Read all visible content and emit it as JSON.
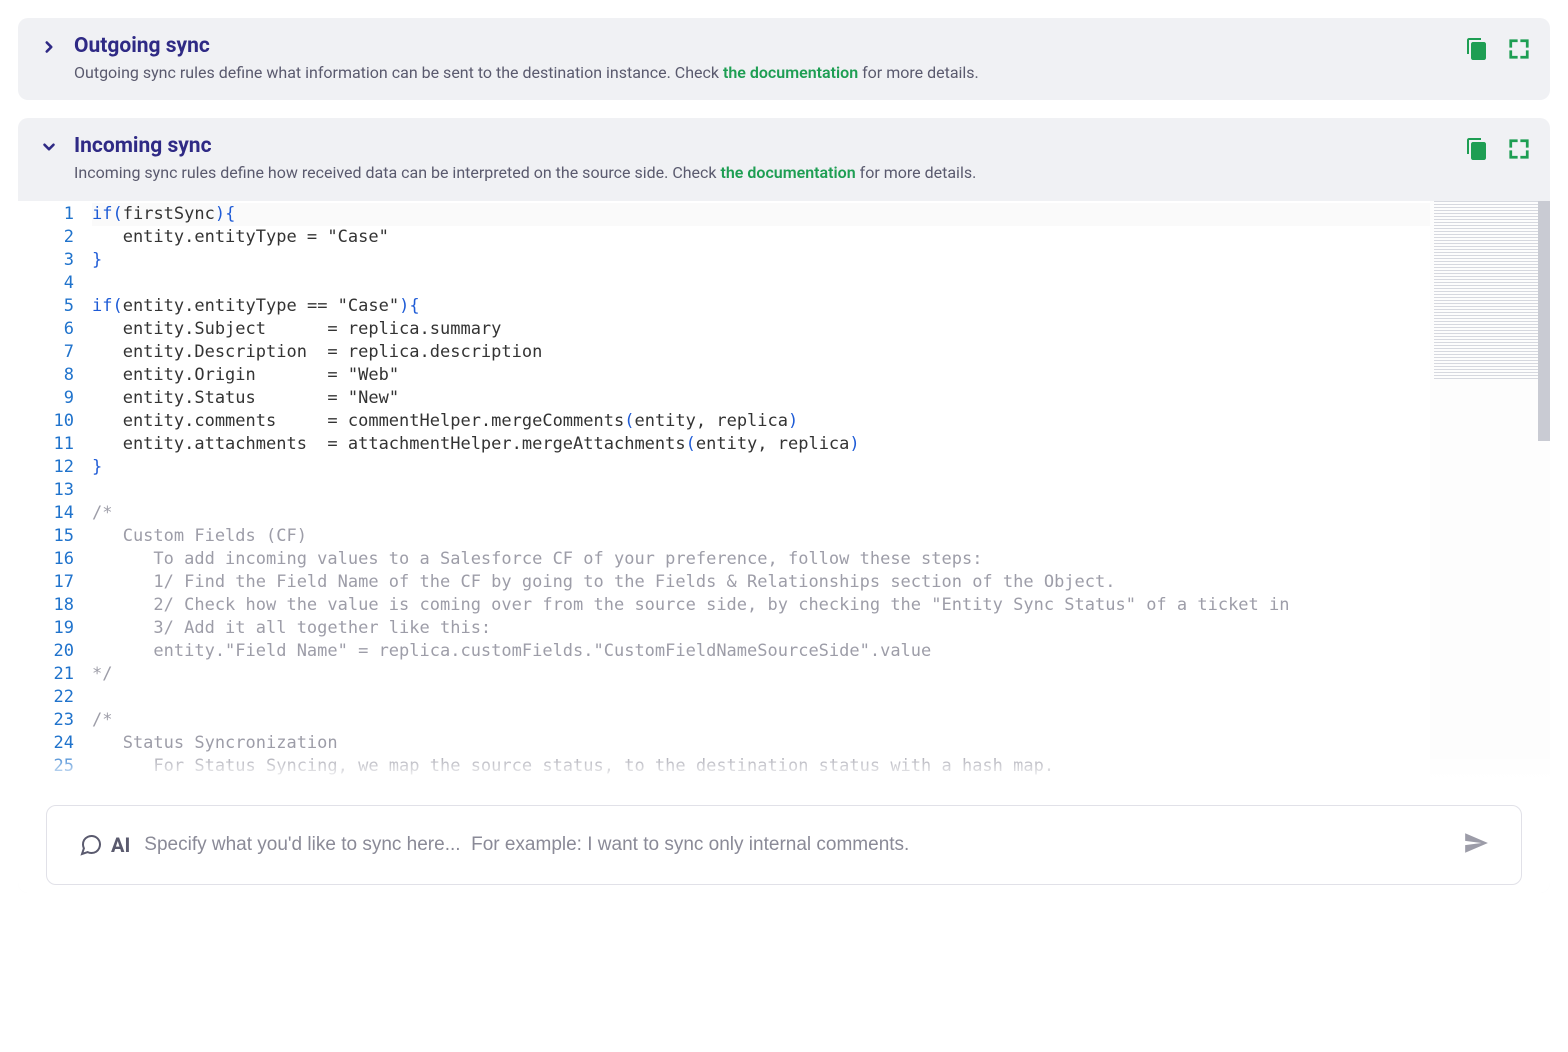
{
  "sections": {
    "outgoing": {
      "title": "Outgoing sync",
      "desc_pre": "Outgoing sync rules define what information can be sent to the destination instance. Check ",
      "doc_link": "the documentation",
      "desc_post": " for more details."
    },
    "incoming": {
      "title": "Incoming sync",
      "desc_pre": "Incoming sync rules define how received data can be interpreted on the source side. Check ",
      "doc_link": "the documentation",
      "desc_post": " for more details."
    }
  },
  "code_lines": [
    "if(firstSync){",
    "   entity.entityType = \"Case\"",
    "}",
    "",
    "if(entity.entityType == \"Case\"){",
    "   entity.Subject      = replica.summary",
    "   entity.Description  = replica.description",
    "   entity.Origin       = \"Web\"",
    "   entity.Status       = \"New\"",
    "   entity.comments     = commentHelper.mergeComments(entity, replica)",
    "   entity.attachments  = attachmentHelper.mergeAttachments(entity, replica)",
    "}",
    "",
    "/*",
    "   Custom Fields (CF)",
    "      To add incoming values to a Salesforce CF of your preference, follow these steps:",
    "      1/ Find the Field Name of the CF by going to the Fields & Relationships section of the Object.",
    "      2/ Check how the value is coming over from the source side, by checking the \"Entity Sync Status\" of a ticket in",
    "      3/ Add it all together like this:",
    "      entity.\"Field Name\" = replica.customFields.\"CustomFieldNameSourceSide\".value",
    "*/",
    "",
    "/*",
    "   Status Syncronization",
    "      For Status Syncing, we map the source status, to the destination status with a hash map."
  ],
  "ai": {
    "label": "AI",
    "placeholder": "Specify what you'd like to sync here...  For example: I want to sync only internal comments."
  }
}
